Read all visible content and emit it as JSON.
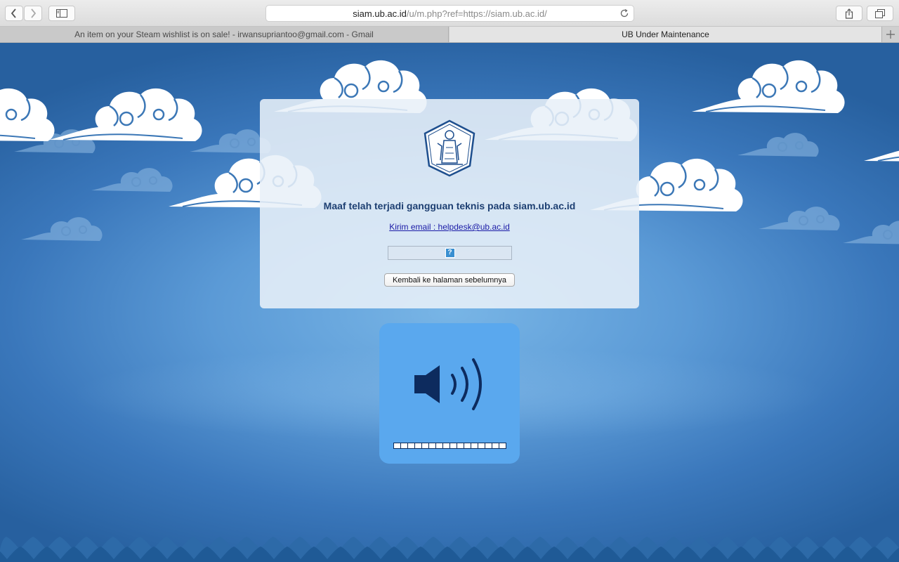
{
  "browser": {
    "url_host": "siam.ub.ac.id",
    "url_path": "/u/m.php?ref=https://siam.ub.ac.id/",
    "tabs": [
      {
        "label": "An item on your Steam wishlist is on sale! - irwansupriantoo@gmail.com - Gmail",
        "active": false
      },
      {
        "label": "UB Under Maintenance",
        "active": true
      }
    ]
  },
  "page": {
    "heading": "Maaf telah terjadi gangguan teknis pada siam.ub.ac.id",
    "email_link": "Kirim email : helpdesk@ub.ac.id",
    "missing_plugin_glyph": "?",
    "back_button": "Kembali ke halaman sebelumnya",
    "logo_icon": "university-crest-icon",
    "volume": {
      "icon": "speaker-volume-icon",
      "level_segments": 16,
      "level": 0
    }
  },
  "colors": {
    "background_blue": "#2f6aa6",
    "card": "#e8f0f8",
    "heading": "#1d3f72",
    "link": "#1a1aa6",
    "volume_panel": "#5aa8ee",
    "speaker": "#0d2b5e"
  }
}
